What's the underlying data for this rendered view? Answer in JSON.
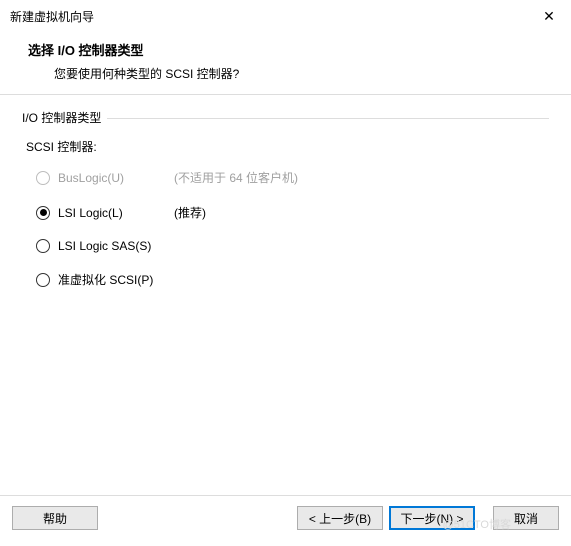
{
  "window": {
    "title": "新建虚拟机向导",
    "close_glyph": "✕"
  },
  "header": {
    "title": "选择 I/O 控制器类型",
    "subtitle": "您要使用何种类型的 SCSI 控制器?"
  },
  "group": {
    "title": "I/O 控制器类型",
    "sub_label": "SCSI 控制器:"
  },
  "options": [
    {
      "label": "BusLogic(U)",
      "hint": "(不适用于 64 位客户机)",
      "selected": false,
      "disabled": true
    },
    {
      "label": "LSI Logic(L)",
      "hint": "(推荐)",
      "selected": true,
      "disabled": false
    },
    {
      "label": "LSI Logic SAS(S)",
      "hint": "",
      "selected": false,
      "disabled": false
    },
    {
      "label": "准虚拟化 SCSI(P)",
      "hint": "",
      "selected": false,
      "disabled": false
    }
  ],
  "buttons": {
    "help": "帮助",
    "back": "< 上一步(B)",
    "next": "下一步(N) >",
    "cancel": "取消"
  },
  "watermark": "@51CTO博客"
}
